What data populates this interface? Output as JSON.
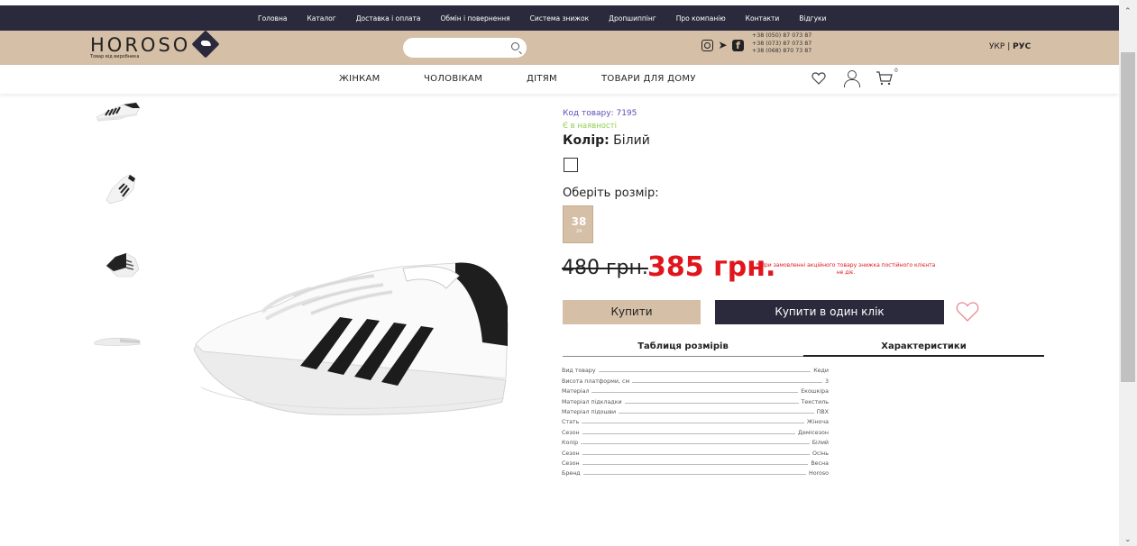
{
  "topbar": {
    "links": [
      "Головна",
      "Каталог",
      "Доставка і оплата",
      "Обмін і повернення",
      "Система знижок",
      "Дропшиппінг",
      "Про компанію",
      "Контакти",
      "Відгуки"
    ]
  },
  "header": {
    "logo_text": "HOROSO",
    "logo_tagline": "Товар від виробника",
    "search_placeholder": "",
    "phones": [
      "+38 (050) 87 073 87",
      "+38 (073) 87 073 87",
      "+38 (068) 870 73 87"
    ],
    "lang_ukr": "УКР",
    "lang_sep": "|",
    "lang_rus": "РУС"
  },
  "nav": {
    "categories": [
      "ЖІНКАМ",
      "ЧОЛОВІКАМ",
      "ДІТЯМ",
      "ТОВАРИ ДЛЯ ДОМУ"
    ],
    "cart_count": "0"
  },
  "product": {
    "code": "Код товару: 7195",
    "stock": "Є в наявності",
    "color_label": "Колір:",
    "color_value": " Білий",
    "size_title": "Оберіть розмір:",
    "size": "38",
    "size_sub": "24",
    "old_price": "480 грн.",
    "new_price": "385 грн.",
    "note": "* При замовленні акційного товару знижка постійного клієнта не діє.",
    "buy_label": "Купити",
    "one_click_label": "Купити в один клік",
    "accent_color": "#d5bfa6",
    "dark_color": "#2b2a3c",
    "price_color": "#e0161d"
  },
  "tabs": [
    "Таблиця розмірів",
    "Характеристики"
  ],
  "specs": [
    {
      "k": "Вид товару",
      "v": "Кеди"
    },
    {
      "k": "Висота платформи, см",
      "v": "3"
    },
    {
      "k": "Матеріал",
      "v": "Екошкіра"
    },
    {
      "k": "Матеріал підкладки",
      "v": "Текстиль"
    },
    {
      "k": "Матеріал підошви",
      "v": "ПВХ"
    },
    {
      "k": "Стать",
      "v": "Жіноча"
    },
    {
      "k": "Сезон",
      "v": "Демісезон"
    },
    {
      "k": "Колір",
      "v": "Білий"
    },
    {
      "k": "Сезон",
      "v": "Осінь"
    },
    {
      "k": "Сезон",
      "v": "Весна"
    },
    {
      "k": "Бренд",
      "v": "Horoso"
    }
  ]
}
